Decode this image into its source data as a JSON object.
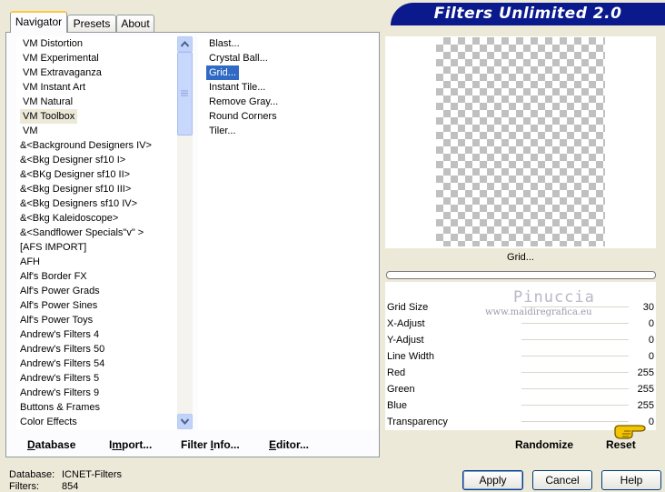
{
  "tabs": [
    {
      "label": "Navigator",
      "active": true
    },
    {
      "label": "Presets",
      "active": false
    },
    {
      "label": "About",
      "active": false
    }
  ],
  "title": "Filters Unlimited 2.0",
  "categories": [
    "VM Distortion",
    "VM Experimental",
    "VM Extravaganza",
    "VM Instant Art",
    "VM Natural",
    "VM Toolbox",
    "VM",
    "&<Background Designers IV>",
    "&<Bkg Designer sf10 I>",
    "&<BKg Designer sf10 II>",
    "&<Bkg Designer sf10 III>",
    "&<Bkg Designers sf10 IV>",
    "&<Bkg Kaleidoscope>",
    "&<Sandflower Specials\"v\" >",
    "[AFS IMPORT]",
    "AFH",
    "Alf's Border FX",
    "Alf's Power Grads",
    "Alf's Power Sines",
    "Alf's Power Toys",
    "Andrew's Filters 4",
    "Andrew's Filters 50",
    "Andrew's Filters 54",
    "Andrew's Filters 5",
    "Andrew's Filters 9",
    "Buttons & Frames",
    "Color Effects"
  ],
  "selected_category": "VM Toolbox",
  "filters": [
    "Blast...",
    "Crystal Ball...",
    "Grid...",
    "Instant Tile...",
    "Remove Gray...",
    "Round Corners",
    "Tiler..."
  ],
  "selected_filter": "Grid...",
  "preview_caption": "Grid...",
  "params": [
    {
      "label": "Grid Size",
      "value": "30"
    },
    {
      "label": "X-Adjust",
      "value": "0"
    },
    {
      "label": "Y-Adjust",
      "value": "0"
    },
    {
      "label": "Line Width",
      "value": "0"
    },
    {
      "label": "Red",
      "value": "255"
    },
    {
      "label": "Green",
      "value": "255"
    },
    {
      "label": "Blue",
      "value": "255"
    },
    {
      "label": "Transparency",
      "value": "0"
    }
  ],
  "watermark": {
    "name": "Pinuccia",
    "url": "www.maidiregrafica.eu"
  },
  "bottom_buttons": {
    "database": {
      "u": "D",
      "rest": "atabase"
    },
    "import": {
      "pre": "I",
      "u": "m",
      "rest": "port..."
    },
    "filter_info": {
      "pre": "Filter ",
      "u": "I",
      "rest": "nfo..."
    },
    "editor": {
      "u": "E",
      "rest": "ditor..."
    },
    "randomize": "Randomize",
    "reset": "Reset"
  },
  "status": {
    "database_label": "Database:",
    "database_value": "ICNET-Filters",
    "filters_label": "Filters:",
    "filters_value": "854"
  },
  "dialog_buttons": {
    "apply": "Apply",
    "cancel": "Cancel",
    "help": "Help"
  },
  "colors": {
    "banner": "#0A1A8C",
    "selection": "#316AC5",
    "accent_tab": "#FFC83C"
  }
}
